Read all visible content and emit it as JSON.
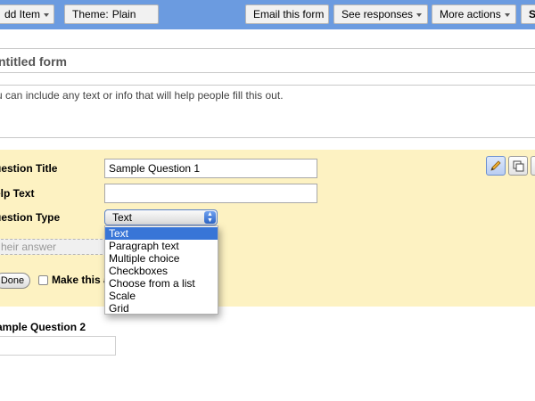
{
  "toolbar": {
    "add_item_label": "dd Item",
    "theme_label": "Theme:",
    "theme_value": "Plain",
    "email_label": "Email this form",
    "responses_label": "See responses",
    "more_actions_label": "More actions",
    "save_label": "S"
  },
  "form": {
    "title": "ntitled form",
    "description": "u can include any text or info that will help people fill this out."
  },
  "question_editor": {
    "title_label": "uestion Title",
    "title_value": "Sample Question 1",
    "help_label": "elp Text",
    "help_value": "",
    "type_label": "uestion Type",
    "type_value": "Text",
    "answer_placeholder": "heir answer",
    "done_label": "Done",
    "required_label": "Make this a"
  },
  "type_dropdown": {
    "options": [
      "Text",
      "Paragraph text",
      "Multiple choice",
      "Checkboxes",
      "Choose from a list",
      "Scale",
      "Grid"
    ],
    "selected_index": 0
  },
  "question2": {
    "title": "ample Question 2"
  },
  "icons": {
    "edit": "pencil-icon",
    "duplicate": "duplicate-icon",
    "delete": "delete-icon"
  },
  "colors": {
    "toolbar": "#6b9be0",
    "editor_bg": "#fdf2c2",
    "selection": "#3875d7"
  }
}
